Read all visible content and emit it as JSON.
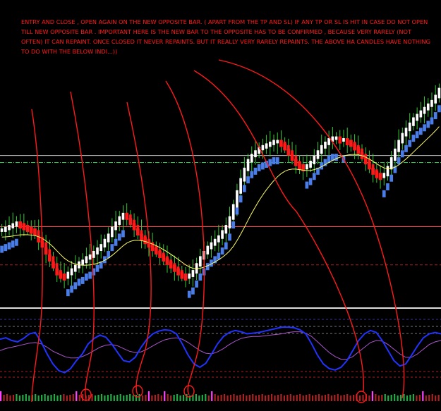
{
  "annotation": {
    "text": "ENTRY AND CLOSE , OPEN AGAIN ON THE NEW OPPOSITE BAR. ( APART FROM THE TP AND SL) IF ANY TP OR SL IS HIT IN CASE DO NOT OPEN TILL NEW OPPOSITE BAR . IMPORTANT HERE IS THE NEW BAR TO THE OPPOSITE HAS TO BE CONFIRMED , BECAUSE VERY RARELY (NOT OFTEN) IT CAN REPAINT. ONCE CLOSED IT NEVER REPAINTS. BUT IT REALLY VERY RARELY REPAINTS. THE ABOVE HA CANDLES HAVE NOTHING TO DO WITH THE BELOW INDI...))",
    "color": "#ff1a1a"
  },
  "colors": {
    "background": "#000000",
    "bull_candle": "#ffffff",
    "bear_candle": "#ff1a1a",
    "wick": "#33cc33",
    "signal_blue": "#4a7de8",
    "signal_red": "#ff1a1a",
    "moving_average": "#ffff66",
    "oscillator_main": "#2233ff",
    "oscillator_signal": "#aa55cc",
    "annotation_line": "#ff1a1a"
  },
  "chart_data": [
    {
      "type": "candlestick",
      "panel": "main",
      "x_count": 120,
      "ohlc_close": [
        0.18,
        0.19,
        0.2,
        0.21,
        0.22,
        0.21,
        0.2,
        0.19,
        0.18,
        0.17,
        0.13,
        0.1,
        0.06,
        0.02,
        -0.02,
        -0.06,
        -0.08,
        -0.09,
        -0.07,
        -0.05,
        -0.03,
        -0.01,
        0.0,
        0.02,
        0.03,
        0.05,
        0.07,
        0.09,
        0.12,
        0.15,
        0.19,
        0.22,
        0.25,
        0.27,
        0.26,
        0.23,
        0.2,
        0.17,
        0.14,
        0.12,
        0.1,
        0.08,
        0.06,
        0.04,
        0.02,
        0.0,
        -0.02,
        -0.04,
        -0.06,
        -0.08,
        -0.09,
        -0.08,
        -0.06,
        -0.02,
        0.02,
        0.05,
        0.08,
        0.1,
        0.12,
        0.14,
        0.17,
        0.2,
        0.25,
        0.32,
        0.4,
        0.47,
        0.53,
        0.58,
        0.61,
        0.63,
        0.65,
        0.66,
        0.67,
        0.68,
        0.69,
        0.69,
        0.68,
        0.66,
        0.63,
        0.6,
        0.57,
        0.55,
        0.54,
        0.55,
        0.57,
        0.6,
        0.63,
        0.66,
        0.68,
        0.7,
        0.71,
        0.71,
        0.7,
        0.7,
        0.69,
        0.68,
        0.66,
        0.64,
        0.61,
        0.58,
        0.55,
        0.52,
        0.5,
        0.49,
        0.5,
        0.54,
        0.59,
        0.64,
        0.69,
        0.73,
        0.76,
        0.79,
        0.82,
        0.84,
        0.86,
        0.88,
        0.9,
        0.92,
        0.95,
        0.99
      ],
      "moving_average_note": "smoothed close",
      "h_lines": [
        {
          "value": 0.61,
          "color": "#bbbbbb",
          "style": "solid"
        },
        {
          "value": 0.57,
          "color": "#22cc44",
          "style": "dashdot"
        },
        {
          "value": 0.2,
          "color": "#ff4444",
          "style": "solid",
          "note": "near top of lows"
        },
        {
          "value": -0.02,
          "color": "#aa2222",
          "style": "dashed"
        }
      ]
    },
    {
      "type": "line",
      "panel": "oscillator",
      "series_main": [
        0.62,
        0.64,
        0.6,
        0.58,
        0.63,
        0.7,
        0.72,
        0.58,
        0.4,
        0.25,
        0.15,
        0.12,
        0.18,
        0.3,
        0.4,
        0.55,
        0.63,
        0.68,
        0.65,
        0.55,
        0.42,
        0.3,
        0.28,
        0.35,
        0.5,
        0.62,
        0.7,
        0.74,
        0.76,
        0.75,
        0.7,
        0.55,
        0.38,
        0.25,
        0.2,
        0.26,
        0.4,
        0.55,
        0.66,
        0.72,
        0.75,
        0.73,
        0.7,
        0.71,
        0.72,
        0.74,
        0.76,
        0.78,
        0.8,
        0.8,
        0.79,
        0.76,
        0.7,
        0.55,
        0.38,
        0.25,
        0.18,
        0.16,
        0.2,
        0.3,
        0.45,
        0.6,
        0.7,
        0.75,
        0.72,
        0.6,
        0.45,
        0.3,
        0.22,
        0.25,
        0.38,
        0.52,
        0.64,
        0.7,
        0.72,
        0.7
      ],
      "series_signal": [
        0.45,
        0.48,
        0.5,
        0.52,
        0.54,
        0.56,
        0.57,
        0.55,
        0.5,
        0.44,
        0.4,
        0.36,
        0.34,
        0.34,
        0.36,
        0.4,
        0.45,
        0.5,
        0.53,
        0.54,
        0.52,
        0.48,
        0.44,
        0.42,
        0.43,
        0.47,
        0.52,
        0.57,
        0.61,
        0.63,
        0.64,
        0.62,
        0.57,
        0.51,
        0.45,
        0.41,
        0.4,
        0.43,
        0.48,
        0.54,
        0.59,
        0.63,
        0.65,
        0.66,
        0.66,
        0.67,
        0.68,
        0.69,
        0.7,
        0.72,
        0.73,
        0.73,
        0.71,
        0.66,
        0.58,
        0.5,
        0.42,
        0.36,
        0.32,
        0.32,
        0.36,
        0.43,
        0.5,
        0.57,
        0.6,
        0.59,
        0.54,
        0.47,
        0.4,
        0.35,
        0.35,
        0.4,
        0.47,
        0.54,
        0.58,
        0.6
      ]
    },
    {
      "type": "bar",
      "panel": "histogram",
      "x_count": 140,
      "highlight_indices": [
        0,
        24,
        47,
        52,
        67,
        118,
        134
      ]
    }
  ]
}
